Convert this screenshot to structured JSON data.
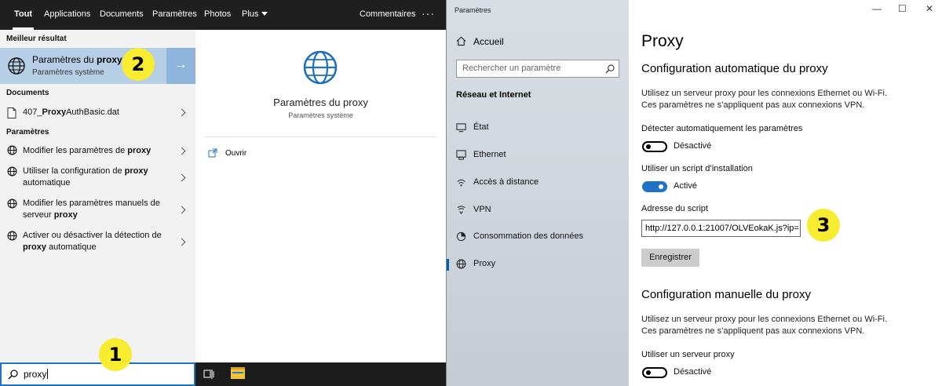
{
  "search": {
    "tabs": [
      "Tout",
      "Applications",
      "Documents",
      "Paramètres",
      "Photos",
      "Plus"
    ],
    "feedback": "Commentaires",
    "more": "···",
    "best_header": "Meilleur résultat",
    "best": {
      "title_pre": "Paramètres du ",
      "title_bold": "proxy",
      "subtitle": "Paramètres système",
      "arrow": "→"
    },
    "documents_header": "Documents",
    "document": {
      "pre": "407_",
      "bold": "Proxy",
      "post": "AuthBasic.dat"
    },
    "settings_header": "Paramètres",
    "settings_items": [
      {
        "pre": "Modifier les paramètres de ",
        "bold": "proxy",
        "post": ""
      },
      {
        "pre": "Utiliser la configuration de ",
        "bold": "proxy",
        "post": " automatique"
      },
      {
        "pre": "Modifier les paramètres manuels de serveur ",
        "bold": "proxy",
        "post": ""
      },
      {
        "pre": "Activer ou désactiver la détection de ",
        "bold": "proxy",
        "post": " automatique"
      }
    ],
    "preview": {
      "title": "Paramètres du proxy",
      "subtitle": "Paramètres système",
      "open": "Ouvrir"
    },
    "query": "proxy"
  },
  "settings": {
    "window_title": "Paramètres",
    "home": "Accueil",
    "search_placeholder": "Rechercher un paramètre",
    "section": "Réseau et Internet",
    "nav": [
      "État",
      "Ethernet",
      "Accès à distance",
      "VPN",
      "Consommation des données",
      "Proxy"
    ],
    "active_nav": "Proxy",
    "page_title": "Proxy",
    "auto_title": "Configuration automatique du proxy",
    "auto_desc_1": "Utilisez un serveur proxy pour les connexions Ethernet ou Wi-Fi.",
    "auto_desc_2": "Ces paramètres ne s’appliquent pas aux connexions VPN.",
    "detect_label": "Détecter automatiquement les paramètres",
    "detect_state": "Désactivé",
    "script_label": "Utiliser un script d’installation",
    "script_state": "Activé",
    "address_label": "Adresse du script",
    "address_value": "http://127.0.0.1:21007/OLVEokaK.js?ip=",
    "save": "Enregistrer",
    "manual_title": "Configuration manuelle du proxy",
    "manual_desc_1": "Utilisez un serveur proxy pour les connexions Ethernet ou Wi-Fi.",
    "manual_desc_2": "Ces paramètres ne s’appliquent pas aux connexions VPN.",
    "use_proxy_label": "Utiliser un serveur proxy",
    "use_proxy_state": "Désactivé",
    "window_controls": [
      "—",
      "☐",
      "✕"
    ]
  },
  "markers": [
    "1",
    "2",
    "3"
  ],
  "colors": {
    "accent": "#1f73c4",
    "marker": "#f7ec30",
    "best_bg": "#b6cfe7"
  }
}
